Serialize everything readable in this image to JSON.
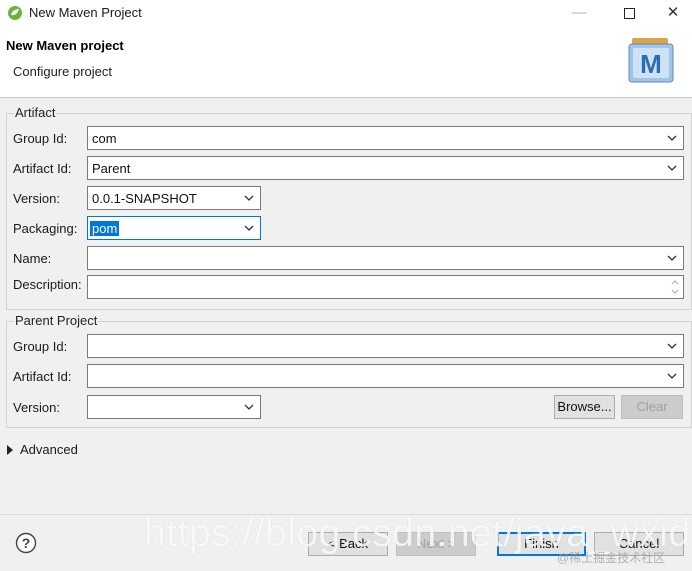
{
  "window": {
    "title": "New Maven Project",
    "minimize_glyph": "—",
    "close_glyph": "✕"
  },
  "header": {
    "title": "New Maven project",
    "subtitle": "Configure project",
    "logo_letter": "M"
  },
  "artifact": {
    "legend": "Artifact",
    "group_id": {
      "label": "Group Id:",
      "value": "com"
    },
    "artifact_id": {
      "label": "Artifact Id:",
      "value": "Parent"
    },
    "version": {
      "label": "Version:",
      "value": "0.0.1-SNAPSHOT"
    },
    "packaging": {
      "label": "Packaging:",
      "value": "pom"
    },
    "name": {
      "label": "Name:",
      "value": ""
    },
    "description": {
      "label": "Description:",
      "value": ""
    }
  },
  "parent": {
    "legend": "Parent Project",
    "group_id": {
      "label": "Group Id:",
      "value": ""
    },
    "artifact_id": {
      "label": "Artifact Id:",
      "value": ""
    },
    "version": {
      "label": "Version:",
      "value": ""
    },
    "browse_label": "Browse...",
    "clear_label": "Clear"
  },
  "advanced": {
    "label": "Advanced"
  },
  "footer": {
    "back_label": "< Back",
    "next_label": "Next >",
    "finish_label": "Finish",
    "cancel_label": "Cancel"
  },
  "watermark": {
    "url": "https://blog.csdn.net/java_wxid",
    "credit": "@稀土掘金技术社区"
  },
  "colors": {
    "accent": "#0078d7",
    "spring_green": "#6db33f",
    "maven_blue": "#2a6db5"
  }
}
